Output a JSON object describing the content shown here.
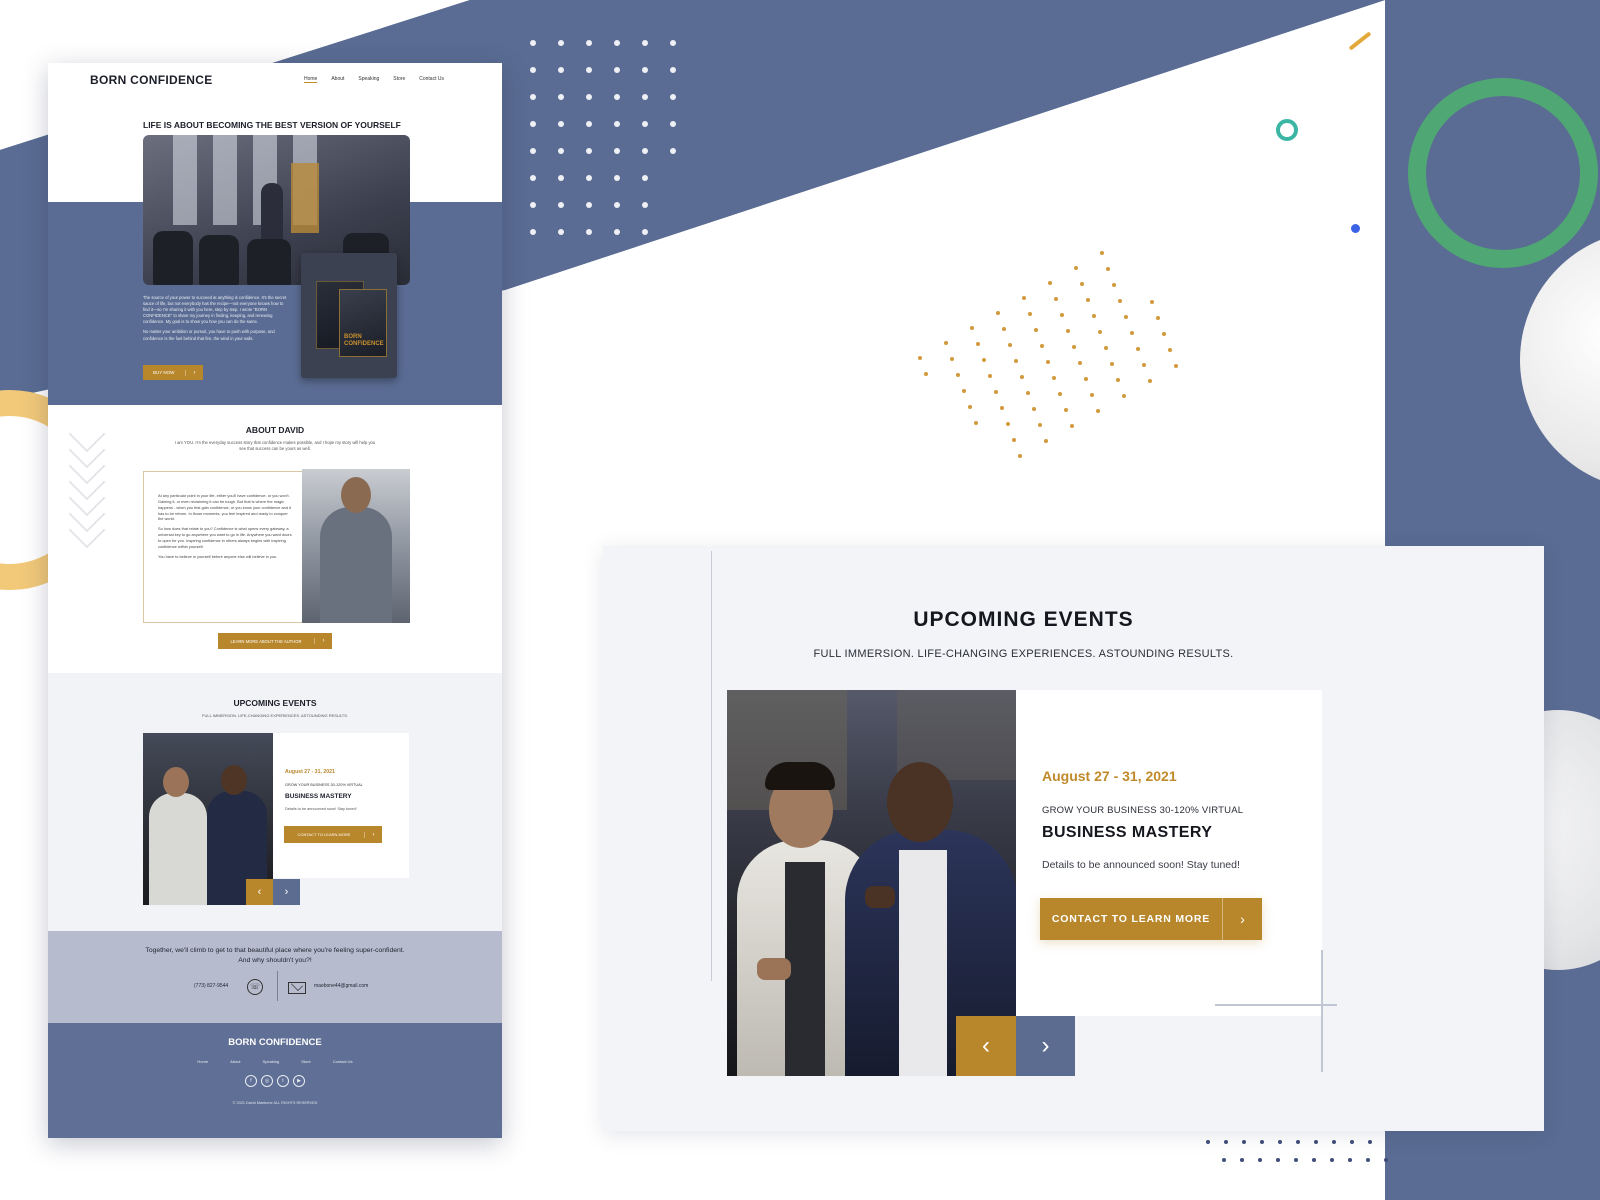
{
  "colors": {
    "slate": "#5a6c93",
    "gold": "#b8862b",
    "green_ring": "#4fa873",
    "panel_bg": "#f3f4f7"
  },
  "mockup": {
    "logo": "BORN CONFIDENCE",
    "nav": [
      "Home",
      "About",
      "Speaking",
      "Store",
      "Contact Us"
    ],
    "hero": {
      "title": "LIFE IS ABOUT BECOMING THE BEST VERSION OF YOURSELF",
      "para1": "The source of your power to succeed at anything is confidence. It's the secret sauce of life, but not everybody has the recipe—not everyone knows how to find it—so I'm sharing it with you here, step by step. I wrote \"BORN CONFIDENCE\" to share my journey in finding, keeping, and renewing confidence. My goal is to show you how you can do the same.",
      "para2": "No matter your ambition or pursuit, you have to push with purpose, and confidence is the fuel behind that fire, the wind in your sails.",
      "button": "BUY NOW",
      "book_text": "BORN CONFIDENCE"
    },
    "about": {
      "title": "ABOUT DAVID",
      "subtitle": "I am YOU. I'm the everyday success story that confidence makes possible, and I hope my story will help you see that success can be yours as well.",
      "para1": "At any particular point in your life, either you'll have confidence, or you won't. Gaining it, or even reclaiming it can be tough. But that is where the magic happens - when you first gain confidence, or you know your confidence and it has to be reborn. In those moments, you feel inspired and ready to conquer the world.",
      "para2": "So how does that relate to you? Confidence is what opens every gateway, a universal key to go anywhere you want to go in life. Anywhere you want doors to open for you. Inspiring confidence in others always begins with inspiring confidence within yourself.",
      "para3": "You have to believe in yourself before anyone else will believe in you.",
      "button": "LEARN MORE ABOUT THE AUTHOR"
    },
    "events": {
      "title": "UPCOMING EVENTS",
      "subtitle": "FULL IMMERSION. LIFE-CHANGING EXPERIENCES. ASTOUNDING RESULTS.",
      "date": "August 27 - 31, 2021",
      "tagline": "GROW YOUR BUSINESS 30-120% VIRTUAL",
      "name": "BUSINESS MASTERY",
      "details": "Details to be announced soon! Stay tuned!",
      "button": "CONTACT TO LEARN MORE"
    },
    "cta": {
      "text": "Together, we'll climb to get to that beautiful place where you're feeling super-confident. And why shouldn't you?!",
      "phone": "(773) 827-9544",
      "email": "maebone44@gmail.com"
    },
    "footer": {
      "logo": "BORN CONFIDENCE",
      "nav": [
        "Home",
        "About",
        "Speaking",
        "Store",
        "Contact Us"
      ],
      "social": [
        "facebook-icon",
        "instagram-icon",
        "twitter-icon",
        "youtube-icon"
      ],
      "copyright": "© 2021 David Maebone ALL RIGHTS RESERVED"
    }
  },
  "panel": {
    "title": "UPCOMING EVENTS",
    "subtitle": "FULL IMMERSION. LIFE-CHANGING EXPERIENCES. ASTOUNDING RESULTS.",
    "date": "August 27 - 31, 2021",
    "tagline": "GROW YOUR BUSINESS 30-120% VIRTUAL",
    "name": "BUSINESS MASTERY",
    "details": "Details to be announced soon! Stay tuned!",
    "button": "CONTACT TO LEARN MORE",
    "prev_icon": "chevron-left-icon",
    "next_icon": "chevron-right-icon"
  }
}
